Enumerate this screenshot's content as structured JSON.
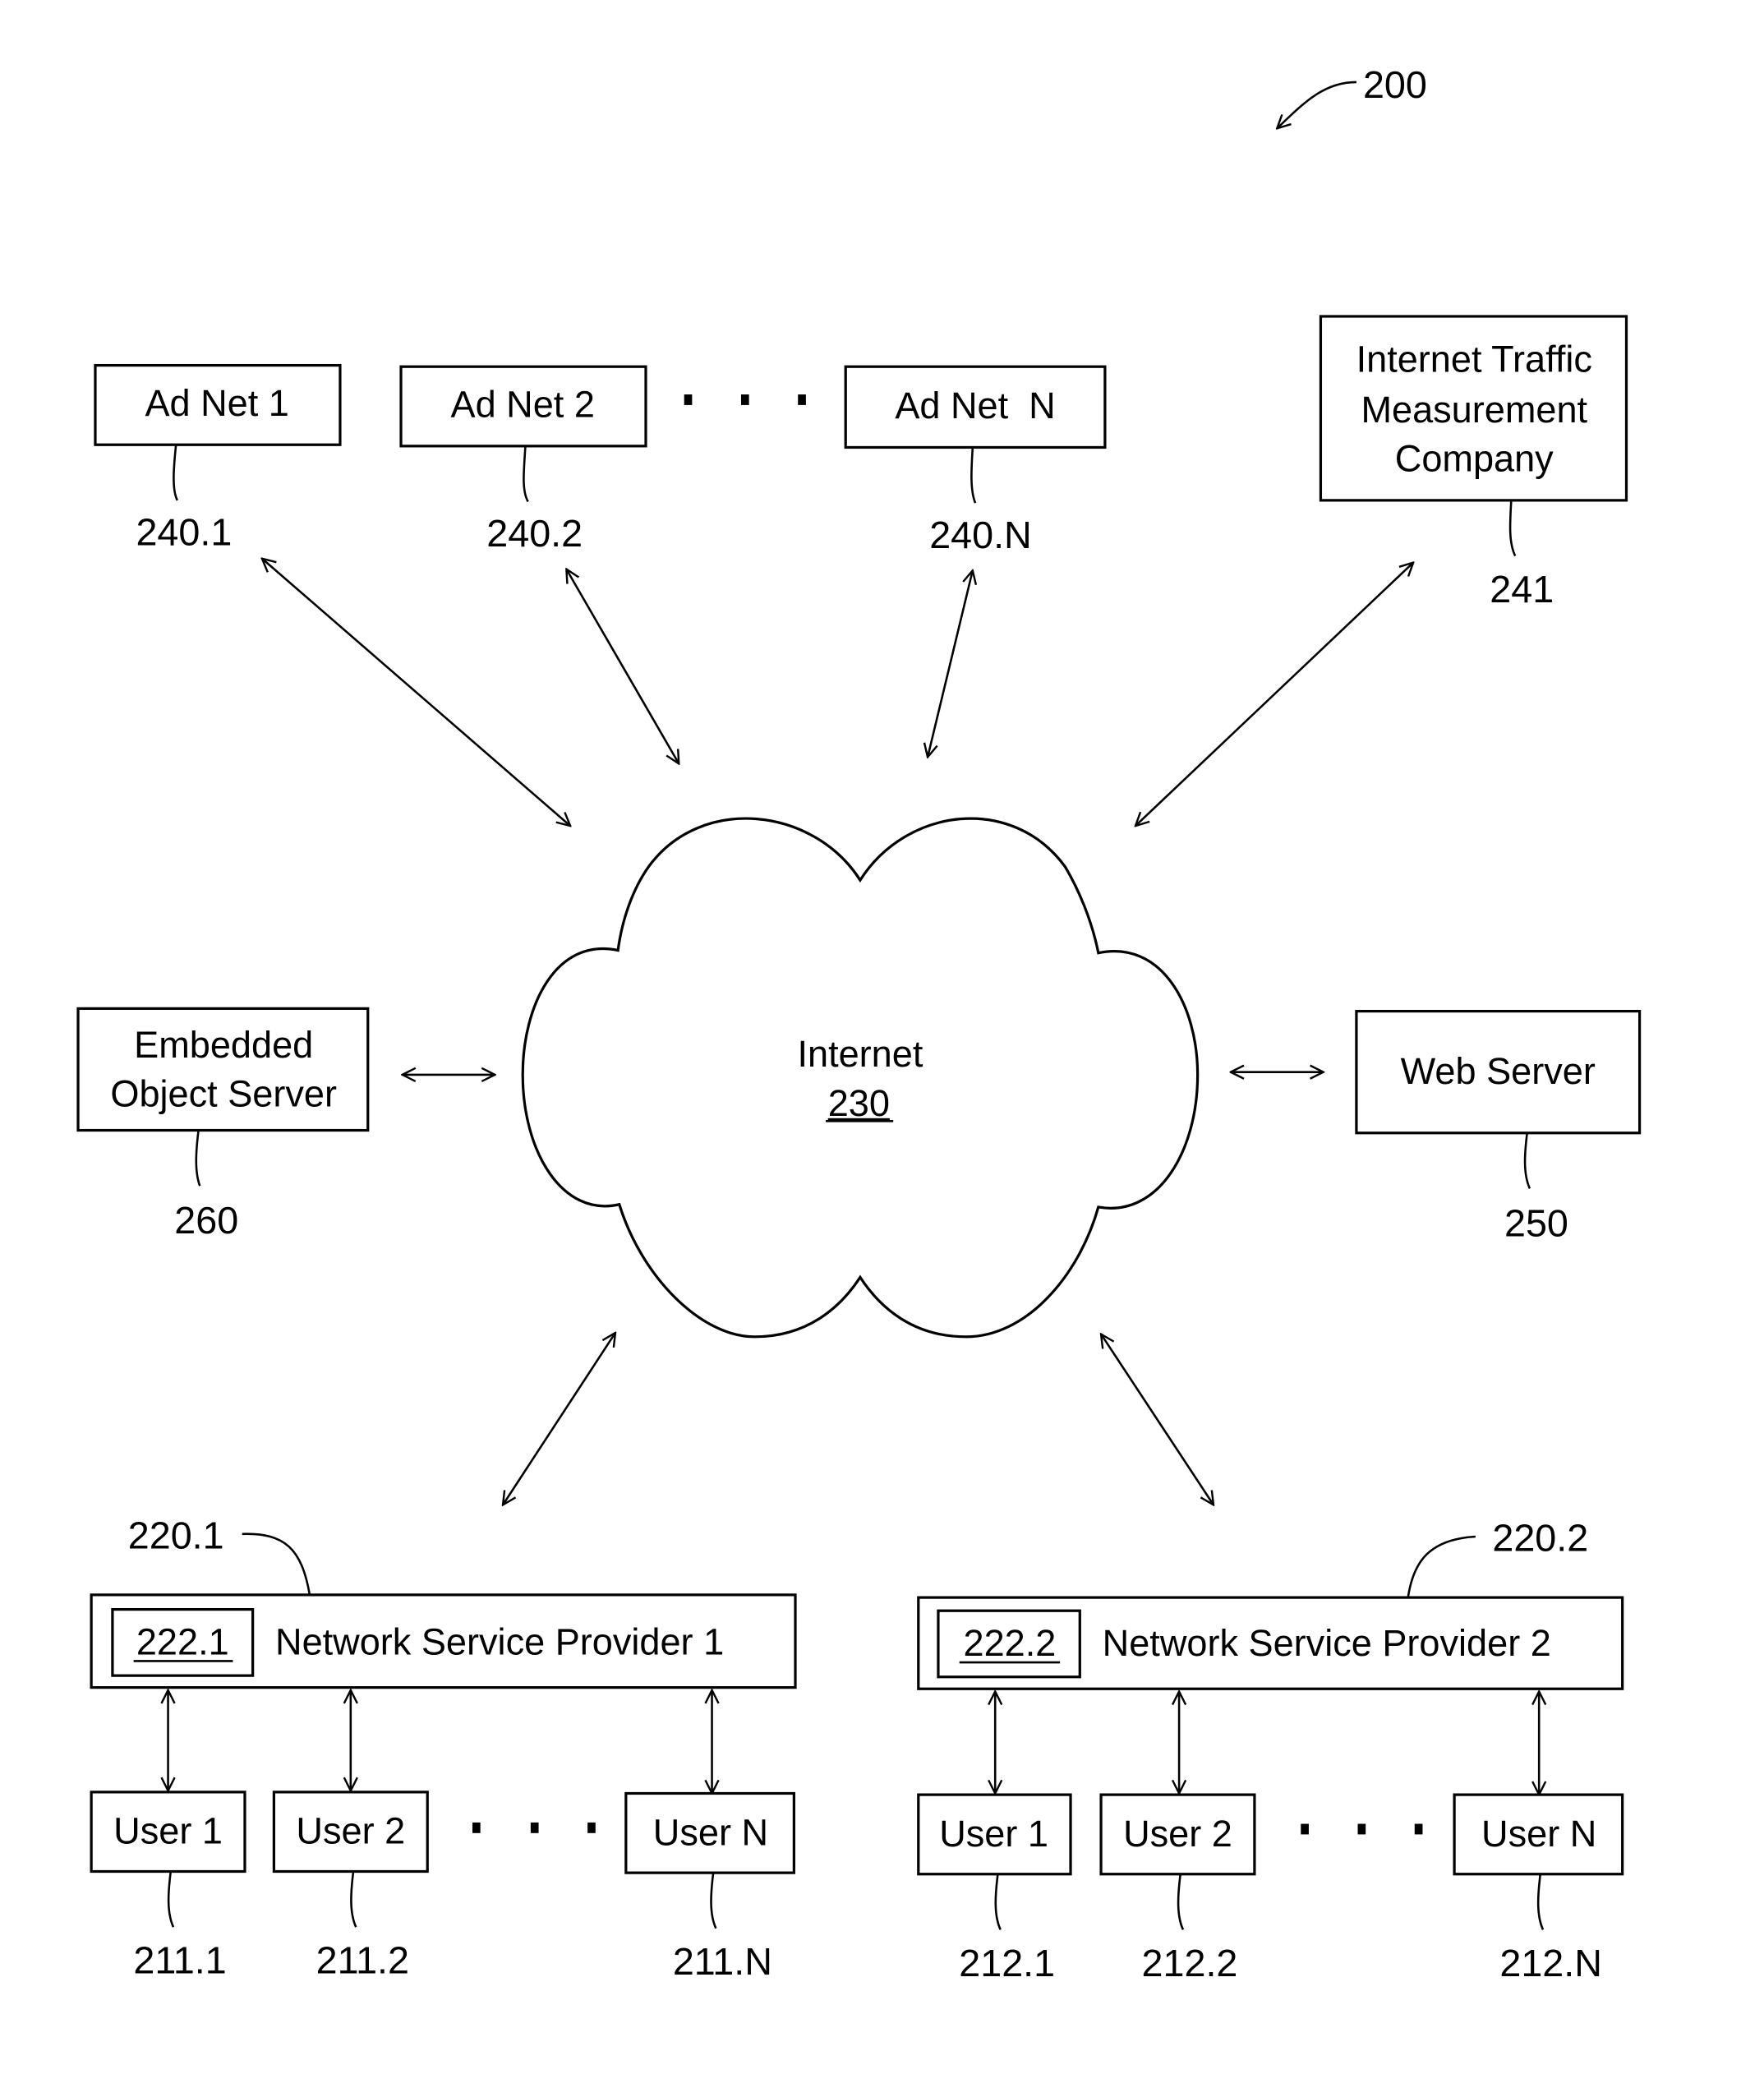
{
  "figure": {
    "ref": "200",
    "cloud": {
      "label": "Internet",
      "ref": "230"
    },
    "ad_nets": [
      {
        "label": "Ad Net 1",
        "ref": "240.1"
      },
      {
        "label": "Ad Net 2",
        "ref": "240.2"
      },
      {
        "label": "Ad Net  N",
        "ref": "240.N"
      }
    ],
    "measurement": {
      "lines": [
        "Internet Traffic",
        "Measurement",
        "Company"
      ],
      "ref": "241"
    },
    "embedded": {
      "lines": [
        "Embedded",
        "Object Server"
      ],
      "ref": "260"
    },
    "web_server": {
      "label": "Web Server",
      "ref": "250"
    },
    "nsp1": {
      "label": "Network Service Provider 1",
      "inner_ref": "222.1",
      "ref": "220.1",
      "users": [
        {
          "label": "User 1",
          "ref": "211.1"
        },
        {
          "label": "User 2",
          "ref": "211.2"
        },
        {
          "label": "User N",
          "ref": "211.N"
        }
      ]
    },
    "nsp2": {
      "label": "Network Service Provider 2",
      "inner_ref": "222.2",
      "ref": "220.2",
      "users": [
        {
          "label": "User 1",
          "ref": "212.1"
        },
        {
          "label": "User 2",
          "ref": "212.2"
        },
        {
          "label": "User N",
          "ref": "212.N"
        }
      ]
    }
  }
}
